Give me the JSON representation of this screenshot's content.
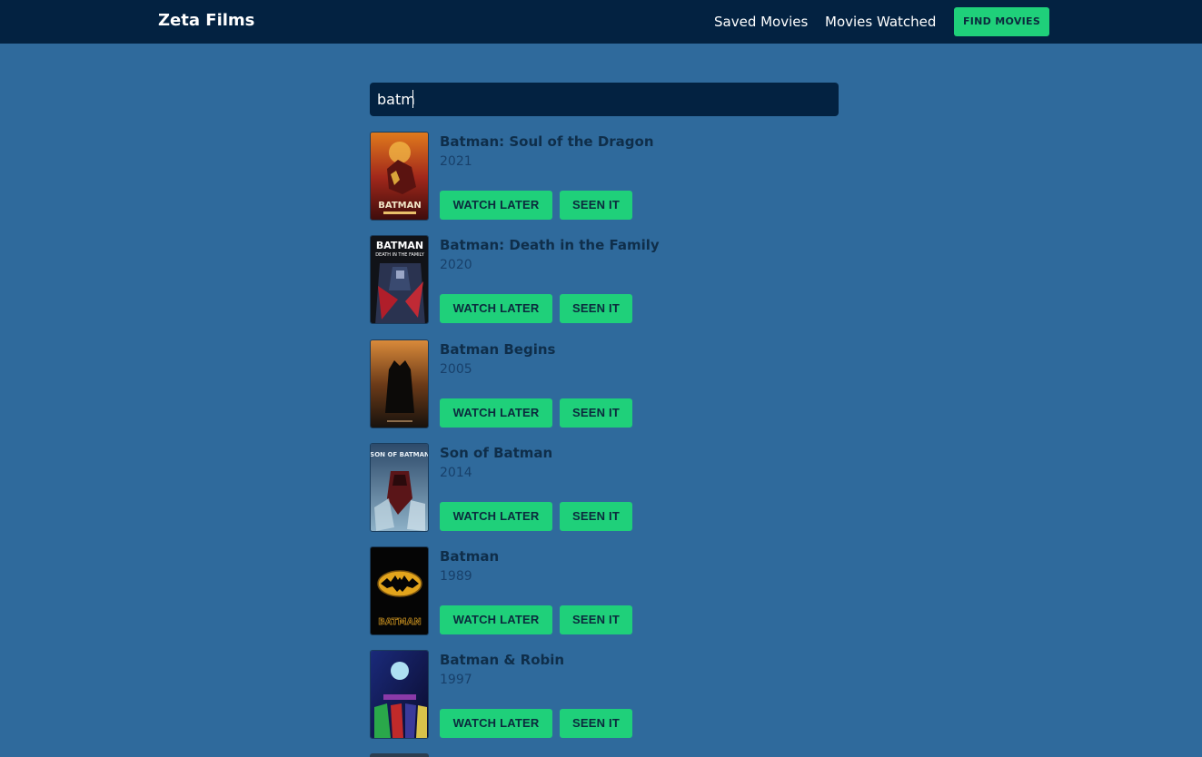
{
  "nav": {
    "brand": "Zeta Films",
    "saved_label": "Saved Movies",
    "watched_label": "Movies Watched",
    "find_label": "FIND MOVIES"
  },
  "search": {
    "value": "batm"
  },
  "buttons": {
    "watch_later": "WATCH LATER",
    "seen_it": "SEEN IT"
  },
  "results": [
    {
      "title": "Batman: Soul of the Dragon",
      "year": "2021",
      "poster_icon": "poster-soul-of-the-dragon"
    },
    {
      "title": "Batman: Death in the Family",
      "year": "2020",
      "poster_icon": "poster-death-in-the-family"
    },
    {
      "title": "Batman Begins",
      "year": "2005",
      "poster_icon": "poster-batman-begins"
    },
    {
      "title": "Son of Batman",
      "year": "2014",
      "poster_icon": "poster-son-of-batman"
    },
    {
      "title": "Batman",
      "year": "1989",
      "poster_icon": "poster-batman-1989"
    },
    {
      "title": "Batman & Robin",
      "year": "1997",
      "poster_icon": "poster-batman-and-robin"
    }
  ],
  "poster_texts": {
    "soul": "BATMAN",
    "death_top": "BATMAN",
    "death_sub": "DEATH IN THE FAMILY",
    "son": "SON OF BATMAN",
    "b89": "BATMAN"
  },
  "colors": {
    "background": "#2f6a9c",
    "navbar": "#032241",
    "accent": "#1fd07a"
  }
}
